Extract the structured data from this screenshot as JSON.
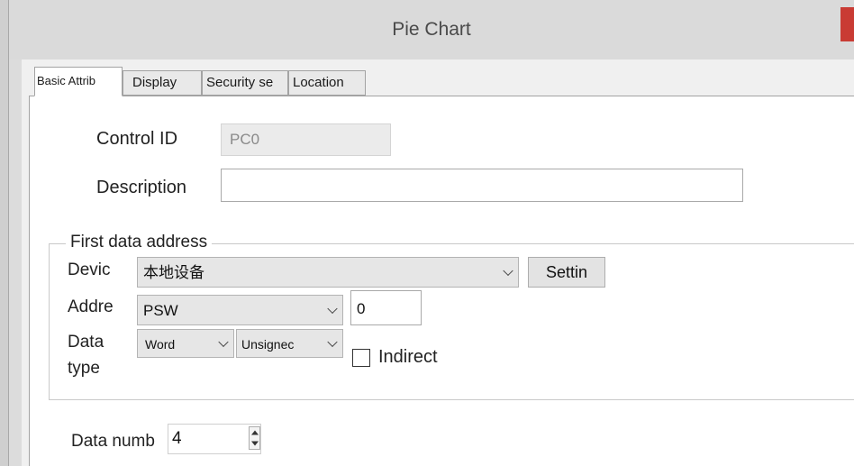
{
  "window": {
    "title": "Pie Chart",
    "close_color": "#c93b34",
    "close_icon": "close-icon"
  },
  "tabs": [
    {
      "label": "Basic Attrib",
      "active": true
    },
    {
      "label": "Display",
      "active": false
    },
    {
      "label": "Security se",
      "active": false
    },
    {
      "label": "Location",
      "active": false
    }
  ],
  "basic": {
    "control_id_label": "Control ID",
    "control_id_value": "PC0",
    "description_label": "Description",
    "description_value": ""
  },
  "first_data_address": {
    "legend": "First data address",
    "device_label": "Devic",
    "device_value": "本地设备",
    "settings_label": "Settin",
    "address_label": "Addre",
    "address_type": "PSW",
    "address_value": "0",
    "data_type_label_1": "Data",
    "data_type_label_2": "type",
    "data_type_value": "Word",
    "data_sign_value": "Unsignec",
    "indirect_label": "Indirect",
    "indirect_checked": false
  },
  "data_number": {
    "label": "Data numb",
    "value": "4"
  }
}
